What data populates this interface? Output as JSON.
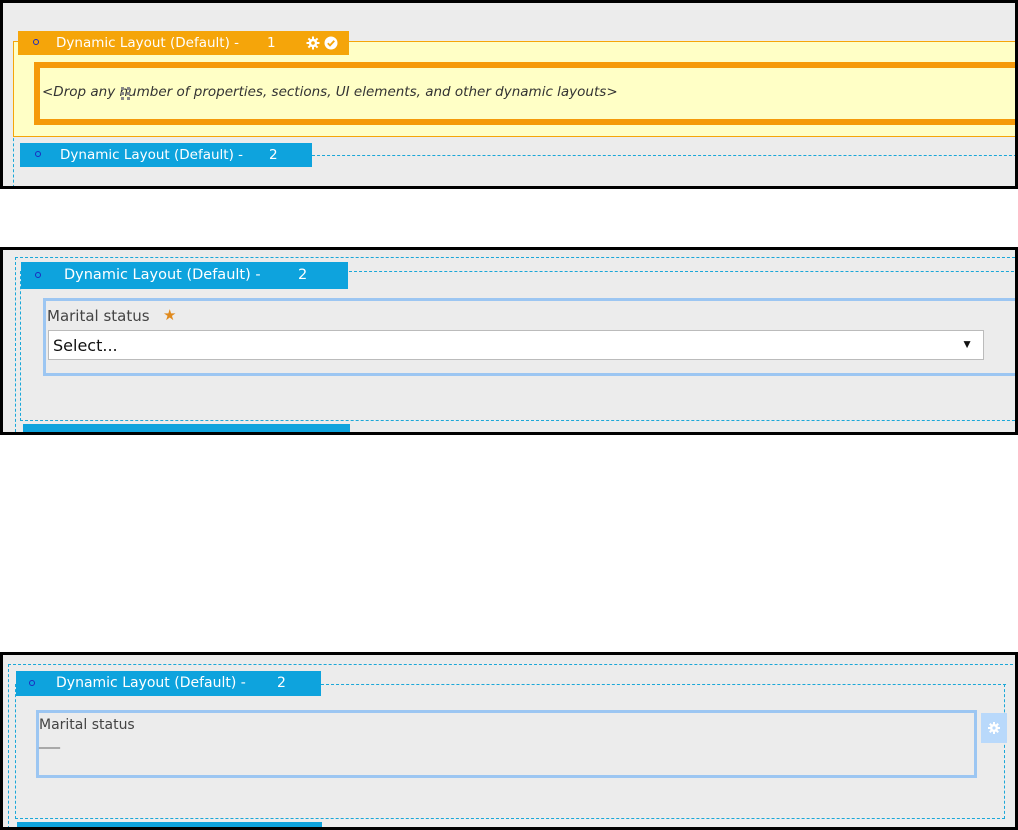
{
  "panel1": {
    "header_label": "Dynamic Layout (Default) -",
    "header_number": "1",
    "drop_text": "<Drop any number of properties, sections, UI elements, and other dynamic layouts>",
    "next_header_label": "Dynamic Layout (Default) -",
    "next_header_number": "2",
    "icons": [
      "gear-icon",
      "checkmark-icon",
      "drag-handle-icon"
    ],
    "colors": {
      "orange": "#f5a50a",
      "yellow": "#ffffc6",
      "blue": "#0ea3dd"
    }
  },
  "panel2": {
    "header_label": "Dynamic Layout (Default) -",
    "header_number": "2",
    "field_label": "Marital status",
    "required_marker": "★",
    "select_value": "Select...",
    "dropdown_arrow": "▼"
  },
  "panel3": {
    "header_label": "Dynamic Layout (Default) -",
    "header_number": "2",
    "field_label": "Marital status",
    "field_value": "___",
    "icons": [
      "gear-icon"
    ]
  }
}
